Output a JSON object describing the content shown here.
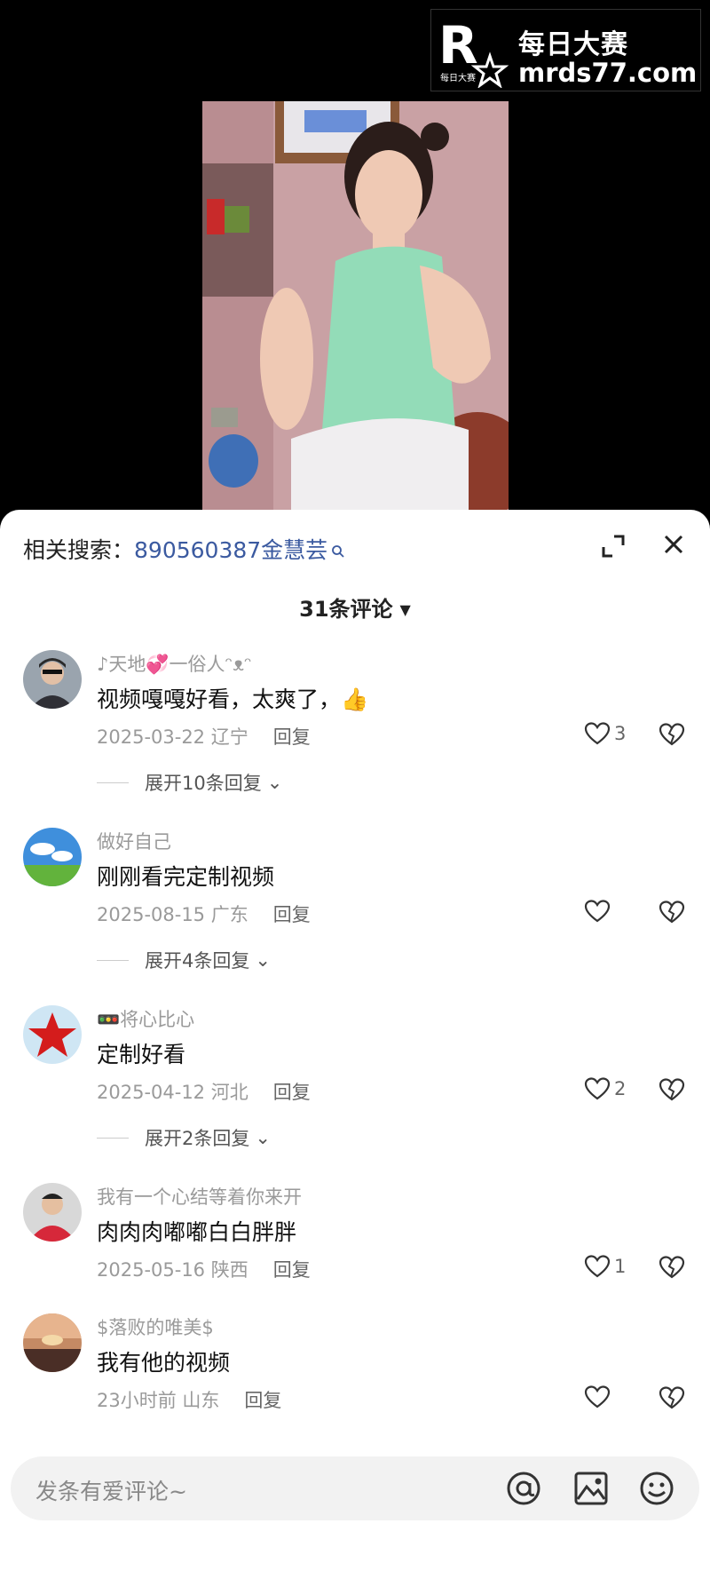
{
  "watermark": {
    "logo_letter": "R",
    "logo_small": "每日大赛",
    "brand_cn": "每日大赛",
    "url": "mrds77.com"
  },
  "related_search": {
    "label": "相关搜索：",
    "query": "890560387金慧芸"
  },
  "comment_count": "31条评论",
  "comments": [
    {
      "user": "♪天地💞一俗人ᵔᴥᵔ",
      "text": "视频嘎嘎好看，太爽了，👍",
      "date": "2025-03-22",
      "region": "辽宁",
      "reply": "回复",
      "likes": "3",
      "expand": "展开10条回复"
    },
    {
      "user": "做好自己",
      "text": "刚刚看完定制视频",
      "date": "2025-08-15",
      "region": "广东",
      "reply": "回复",
      "likes": "",
      "expand": "展开4条回复"
    },
    {
      "user": "🚥将心比心",
      "text": "定制好看",
      "date": "2025-04-12",
      "region": "河北",
      "reply": "回复",
      "likes": "2",
      "expand": "展开2条回复"
    },
    {
      "user": "我有一个心结等着你来开",
      "text": "肉肉肉嘟嘟白白胖胖",
      "date": "2025-05-16",
      "region": "陕西",
      "reply": "回复",
      "likes": "1",
      "expand": ""
    },
    {
      "user": "$落败的唯美$",
      "text": "我有他的视频",
      "date": "23小时前",
      "region": "山东",
      "reply": "回复",
      "likes": "",
      "expand": ""
    }
  ],
  "input": {
    "placeholder": "发条有爱评论~"
  },
  "icons": {
    "search": "search-icon",
    "expand": "expand-icon",
    "close": "close-icon",
    "caret": "caret-down-icon",
    "like": "heart-icon",
    "dislike": "broken-heart-icon",
    "mention": "at-icon",
    "image": "image-icon",
    "emoji": "emoji-icon"
  },
  "colors": {
    "link": "#3b5aa0",
    "muted": "#9a9a9a",
    "text": "#111111"
  }
}
